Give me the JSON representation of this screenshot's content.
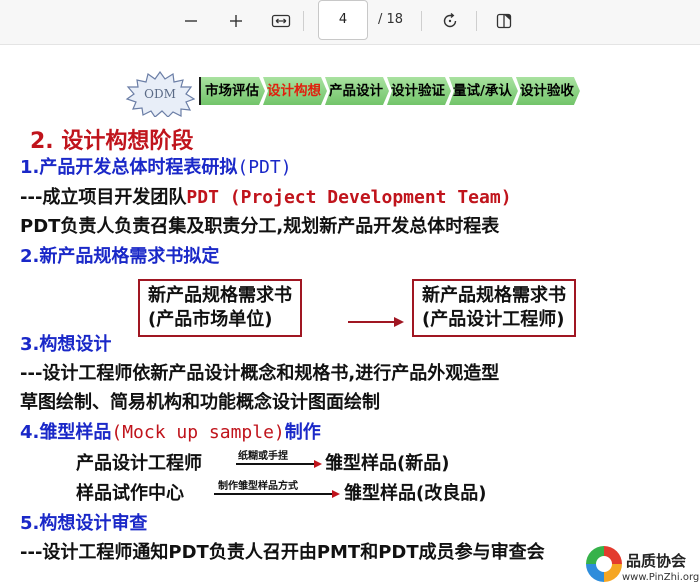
{
  "toolbar": {
    "zoom_out_icon": "minus-icon",
    "zoom_in_icon": "plus-icon",
    "fit_icon": "fit-width-icon",
    "page_current": "4",
    "page_total": "/ 18",
    "rotate_icon": "rotate-icon",
    "pages_icon": "page-view-icon"
  },
  "slide": {
    "badge": "ODM",
    "process_steps": [
      "市场评估",
      "设计构想",
      "产品设计",
      "设计验证",
      "量试/承认",
      "设计验收"
    ],
    "active_step": 1,
    "section_title": "2. 设计构想阶段",
    "item1_title": "1.产品开发总体时程表研拟",
    "item1_suffix": "(PDT)",
    "item1_line1_prefix": "---成立项目开发团队",
    "item1_line1_term": "PDT (Project Development Team)",
    "item1_line2": "PDT负责人负责召集及职责分工,规划新产品开发总体时程表",
    "item2_title": "2.新产品规格需求书拟定",
    "box_left_line1": "新产品规格需求书",
    "box_left_line2": "(产品市场单位)",
    "box_right_line1": "新产品规格需求书",
    "box_right_line2": "(产品设计工程师)",
    "item3_title": "3.构想设计",
    "item3_line1": "---设计工程师依新产品设计概念和规格书,进行产品外观造型",
    "item3_line2": "草图绘制、简易机构和功能概念设计图面绘制",
    "item4_title_a": "4.雏型样品",
    "item4_title_term": "(Mock up sample)",
    "item4_title_b": "制作",
    "flow1_from": "产品设计工程师",
    "flow1_label": "纸糊或手捏",
    "flow1_to": "雏型样品(新品)",
    "flow2_from": "样品试作中心",
    "flow2_label": "制作雏型样品方式",
    "flow2_to": "雏型样品(改良品)",
    "item5_title": "5.构想设计审查",
    "item5_line1": "---设计工程师通知PDT负责人召开由PMT和PDT成员参与审查会"
  },
  "watermark": {
    "title": "品质协会",
    "url": "www.PinZhi.org"
  },
  "colors": {
    "blue": "#1a28c8",
    "red": "#c0141c",
    "step_green": "#72c46a",
    "box_border": "#a01622"
  }
}
